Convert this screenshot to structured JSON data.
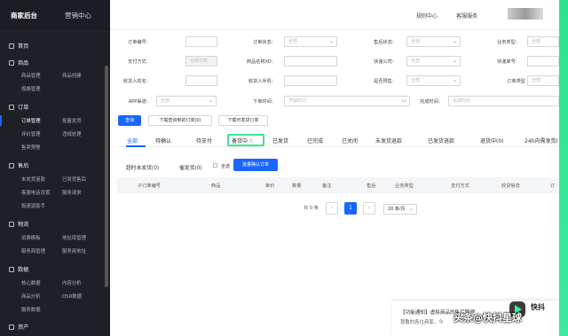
{
  "brand": {
    "title": "商家后台",
    "subtitle": "营销中心"
  },
  "top_links": [
    "规则中心",
    "客服服务"
  ],
  "sidebar": {
    "home": "首页",
    "sections": [
      {
        "title": "商品",
        "items": [
          "商品管理",
          "商品创建",
          "规格管理"
        ]
      },
      {
        "title": "订单",
        "items": [
          "订单管理",
          "批量发货",
          "评价管理",
          "违规处理",
          "售卖预警"
        ]
      },
      {
        "title": "售后",
        "items": [
          "未发货退款",
          "已发货售后",
          "客服电话设置",
          "服务请求",
          "极速退助手"
        ]
      },
      {
        "title": "物流",
        "items": [
          "运费模板",
          "地址库管理",
          "服务商管理",
          "服务商地址"
        ]
      },
      {
        "title": "数据",
        "items": [
          "核心数据",
          "内容分析",
          "商品分析",
          "DSR数据",
          "服务数据"
        ]
      },
      {
        "title": "资产",
        "items": []
      }
    ]
  },
  "filters": [
    {
      "label": "订单编号：",
      "value": ""
    },
    {
      "label": "订单状态：",
      "value": "全部"
    },
    {
      "label": "售后状态：",
      "value": "全部"
    },
    {
      "label": "业务类型：",
      "value": "全部"
    },
    {
      "label": "支付方式：",
      "value": "在线付款"
    },
    {
      "label": "商品名称/ID：",
      "value": ""
    },
    {
      "label": "快递公司：",
      "value": "全部"
    },
    {
      "label": "快递单号：",
      "value": ""
    },
    {
      "label": "收货人姓名：",
      "value": ""
    },
    {
      "label": "收货人手机：",
      "value": ""
    },
    {
      "label": "是否预售：",
      "value": "全部"
    },
    {
      "label": "订单类型",
      "value": "全部"
    },
    {
      "label": "APP渠道：",
      "value": "全部"
    },
    {
      "label": "下单时间：",
      "value": "开始时间"
    },
    {
      "label": "完成时间：",
      "value": "完成时间"
    }
  ],
  "buttons": {
    "search": "查询",
    "export_all": "下载查询到的订单(0)",
    "export_shippable": "下载可发货订单"
  },
  "tabs": [
    "全部",
    "待确认",
    "待支付",
    "备货中",
    "已发货",
    "已完成",
    "已关闭",
    "未发货退款",
    "已发货退款",
    "退货中(0)",
    "24h内需发货("
  ],
  "tab_badge": "0",
  "subtabs": {
    "overdue": "超时未发货(0)",
    "pending": "催发货(0)",
    "select_all": "全选",
    "batch_confirm": "批量确认订单"
  },
  "table_headers": [
    "子订单编号",
    "商品",
    "单价",
    "数量",
    "备注",
    "售后",
    "业务类型",
    "支付方式",
    "收货信息",
    "订"
  ],
  "pagination": {
    "total": "共 0 条",
    "page": "1",
    "page_size": "20 条/页"
  },
  "notice": {
    "title": "【功能通知】虚拟商品的售后管理",
    "body": "尊敬的各位商家，今"
  },
  "watermark": {
    "tag": "快抖",
    "text": "头条@快抖星球"
  },
  "colors": {
    "primary": "#1966ff",
    "sidebar": "#1f2026",
    "highlight": "#43e48f"
  }
}
